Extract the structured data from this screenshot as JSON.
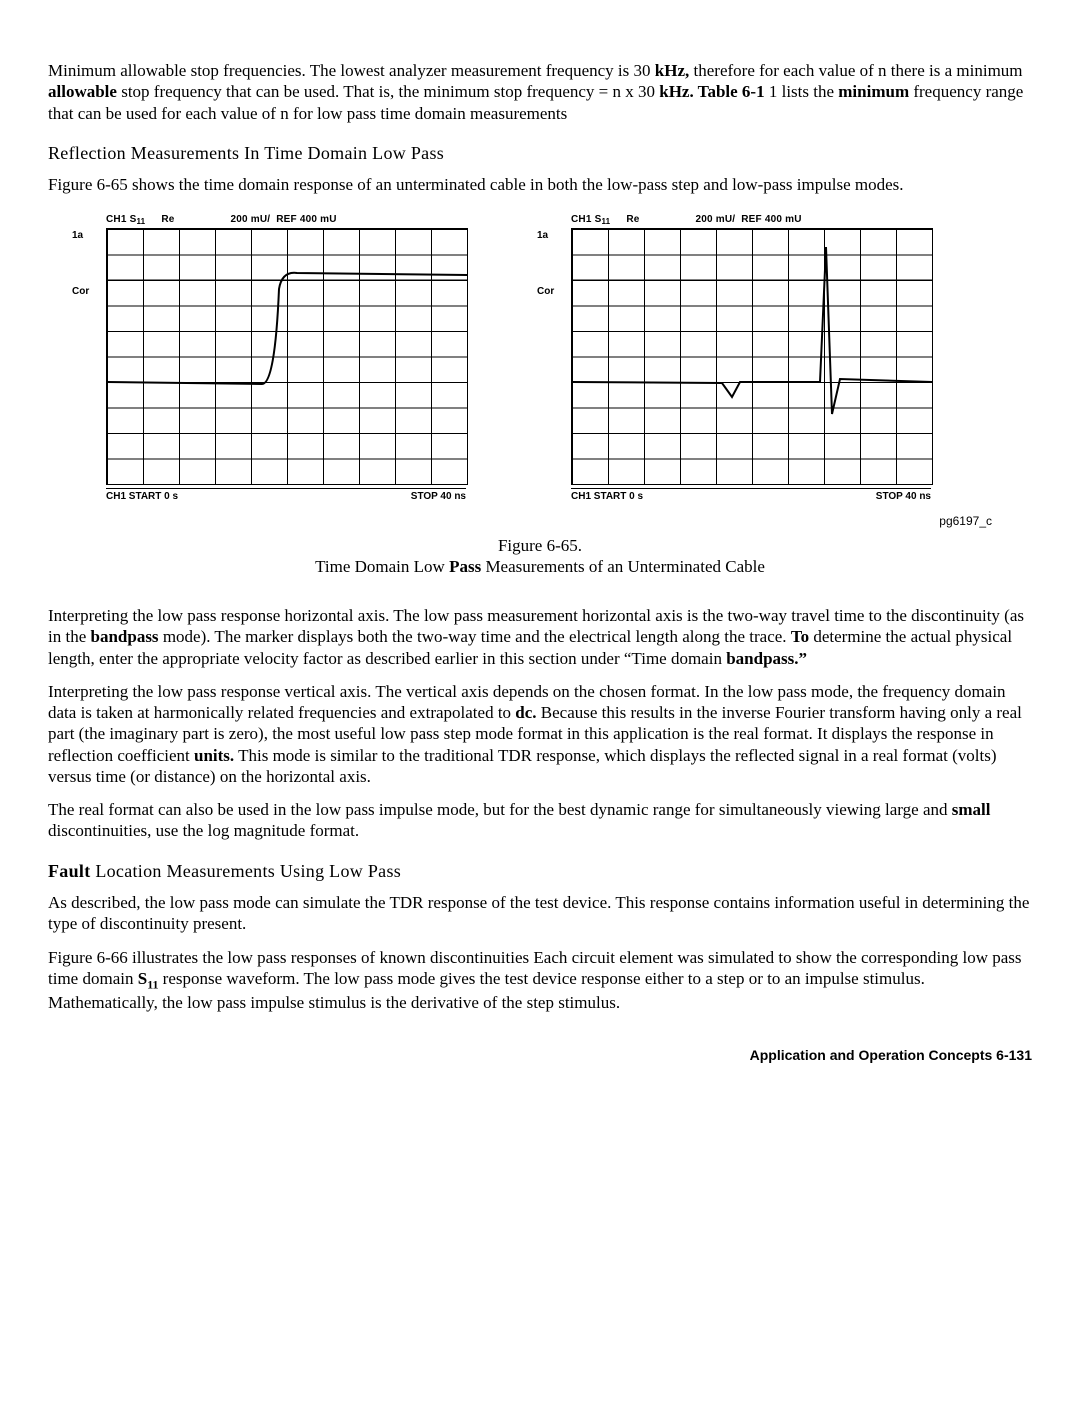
{
  "p1a": "Minimum allowable stop frequencies. The lowest analyzer measurement frequency is 30 ",
  "p1b": "kHz,",
  "p1c": " therefore for each value of n there is a minimum ",
  "p1d": "allowable",
  "p1e": " stop frequency that can be used. That is, the minimum stop frequency = n x 30 ",
  "p1f": "kHz. Table 6-1",
  "p1g": " 1 lists the ",
  "p1h": "minimum",
  "p1i": " frequency range that can be used for each value of n for low pass time domain measurements",
  "h1": "Reflection Measurements In Time Domain Low Pass",
  "p2": "Figure 6-65 shows the time domain response of an unterminated cable in both the low-pass step and low-pass impulse modes.",
  "chart_data": [
    {
      "type": "line",
      "title_left": "CH1 S",
      "title_sub": "11",
      "title_re": "Re",
      "scale": "200 mU/",
      "ref": "REF 400 mU",
      "side1": "1a",
      "cor": "Cor",
      "start": "CH1 START 0 s",
      "stop": "STOP 40 ns",
      "x_range_ns": [
        0,
        40
      ],
      "trace": "step rising at ~14 ns to ~+1 unit, flat before near -0.1"
    },
    {
      "type": "line",
      "title_left": "CH1 S",
      "title_sub": "11",
      "title_re": "Re",
      "scale": "200 mU/",
      "ref": "REF 400 mU",
      "side1": "1a",
      "cor": "Cor",
      "start": "CH1 START 0 s",
      "stop": "STOP 40 ns",
      "x_range_ns": [
        0,
        40
      ],
      "trace": "impulse near 0 at baseline, precursor dip ~12 ns, large spike ~28 ns"
    }
  ],
  "figtag": "pg6197_c",
  "cap1": "Figure 6-65.",
  "cap2a": "Time Domain Low ",
  "cap2b": "Pass",
  "cap2c": " Measurements of an Unterminated Cable",
  "p3a": "Interpreting the low pass response horizontal axis. The low pass measurement horizontal axis is the two-way travel time to the discontinuity (as in the ",
  "p3b": "bandpass",
  "p3c": " mode). The marker displays both the two-way time and the electrical length along the trace. ",
  "p3d": "To",
  "p3e": " determine the actual physical length, enter the appropriate velocity factor as described earlier in this section under “Time domain ",
  "p3f": "bandpass.”",
  "p4a": "Interpreting the low pass response vertical axis. The vertical axis depends on the chosen format. In the low pass mode, the frequency domain data is taken at harmonically related frequencies and extrapolated to ",
  "p4b": "dc.",
  "p4c": " Because this results in the inverse Fourier transform having only a real part (the imaginary part is zero), the most useful low pass step mode format in this application is the real format. It displays the response in reflection coefficient ",
  "p4d": "units.",
  "p4e": " This mode is similar to the traditional TDR response, which displays the reflected signal in a real format (volts) versus time (or distance) on the horizontal axis.",
  "p5a": "The real format can also be used in the low pass impulse mode, but for the best dynamic range for simultaneously viewing large and ",
  "p5b": "small",
  "p5c": " discontinuities, use the log magnitude format.",
  "h2a": "Fault",
  "h2b": " Location Measurements Using Low Pass",
  "p6": "As described, the low pass mode can simulate the TDR response of the test device. This response contains information useful in determining the type of discontinuity present.",
  "p7a": "Figure 6-66 illustrates the low pass responses of known discontinuities Each circuit element was simulated to show the corresponding low pass time domain ",
  "p7b": "S",
  "p7c": "11",
  "p7d": " response waveform. The low pass mode gives the test device response either to a step or to an impulse stimulus. Mathematically, the low pass impulse stimulus is the derivative of the step stimulus.",
  "footer": "Application and Operation Concepts    6-131"
}
